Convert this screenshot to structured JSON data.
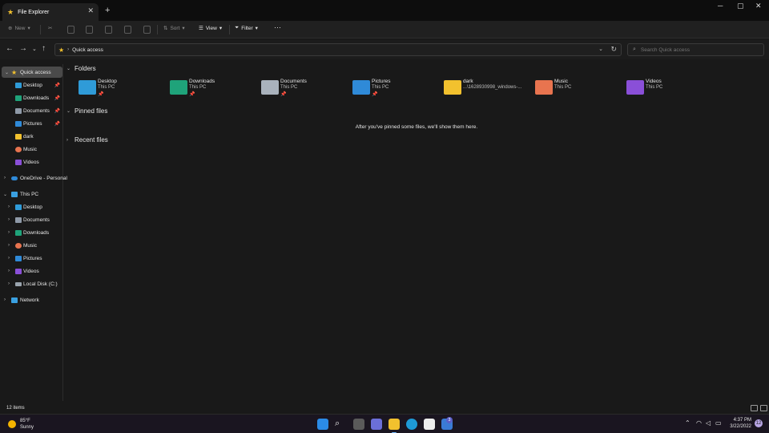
{
  "window": {
    "tab_title": "File Explorer",
    "tab_close": "✕",
    "new_tab": "+",
    "minimize": "─",
    "maximize": "▢",
    "close": "✕"
  },
  "commandbar": {
    "new_label": "New",
    "sort_label": "Sort",
    "view_label": "View",
    "filter_label": "Filter",
    "more_label": "···"
  },
  "address": {
    "location": "Quick access",
    "search_placeholder": "Search Quick access"
  },
  "sidebar": {
    "quick_access": {
      "label": "Quick access",
      "color": "#f2c12e"
    },
    "pinned": [
      {
        "label": "Desktop",
        "color": "#2f9bd8",
        "pinned": true
      },
      {
        "label": "Downloads",
        "color": "#1fa37a",
        "pinned": true
      },
      {
        "label": "Documents",
        "color": "#8f9aa8",
        "pinned": true
      },
      {
        "label": "Pictures",
        "color": "#2f8ad8",
        "pinned": true
      },
      {
        "label": "dark",
        "color": "#f2c12e",
        "pinned": false
      },
      {
        "label": "Music",
        "color": "#e8744f",
        "pinned": false
      },
      {
        "label": "Videos",
        "color": "#8a4fd8",
        "pinned": false
      }
    ],
    "onedrive": {
      "label": "OneDrive - Personal",
      "color": "#2f8ad8"
    },
    "this_pc": {
      "label": "This PC",
      "color": "#3aa0e0"
    },
    "pc_items": [
      {
        "label": "Desktop",
        "color": "#2f9bd8"
      },
      {
        "label": "Documents",
        "color": "#8f9aa8"
      },
      {
        "label": "Downloads",
        "color": "#1fa37a"
      },
      {
        "label": "Music",
        "color": "#e8744f"
      },
      {
        "label": "Pictures",
        "color": "#2f8ad8"
      },
      {
        "label": "Videos",
        "color": "#8a4fd8"
      },
      {
        "label": "Local Disk (C:)",
        "color": "#9aa4ae"
      }
    ],
    "network": {
      "label": "Network",
      "color": "#3aa0e0"
    },
    "pin_glyph": "📌"
  },
  "content": {
    "folders_heading": "Folders",
    "pinned_heading": "Pinned files",
    "recent_heading": "Recent files",
    "empty_pinned_message": "After you've pinned some files, we'll show them here.",
    "folders": [
      {
        "name": "Desktop",
        "sub": "This PC",
        "pinned": true,
        "color": "#2f9bd8"
      },
      {
        "name": "Downloads",
        "sub": "This PC",
        "pinned": true,
        "color": "#1fa37a"
      },
      {
        "name": "Documents",
        "sub": "This PC",
        "pinned": true,
        "color": "#a9b2bc"
      },
      {
        "name": "Pictures",
        "sub": "This PC",
        "pinned": true,
        "color": "#2f8ad8"
      },
      {
        "name": "dark",
        "sub": "...\\1628930998_windows-...",
        "pinned": false,
        "color": "#f2c12e"
      },
      {
        "name": "Music",
        "sub": "This PC",
        "pinned": false,
        "color": "#e8744f"
      },
      {
        "name": "Videos",
        "sub": "This PC",
        "pinned": false,
        "color": "#8a4fd8"
      }
    ]
  },
  "status": {
    "item_count": "12 items"
  },
  "taskbar": {
    "temperature": "85°F",
    "condition": "Sunny",
    "time": "4:37 PM",
    "date": "3/22/2022",
    "notifications": "12",
    "store_badge": "3"
  }
}
